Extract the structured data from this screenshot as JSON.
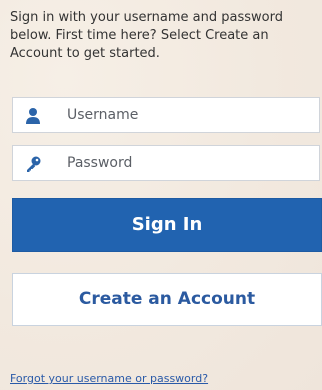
{
  "intro": {
    "text": "Sign in with your username and password below. First time here? Select Create an Account to get started."
  },
  "username": {
    "placeholder": "Username",
    "value": "",
    "icon": "user-icon"
  },
  "password": {
    "placeholder": "Password",
    "value": "",
    "icon": "key-icon"
  },
  "buttons": {
    "signin_label": "Sign In",
    "create_label": "Create an Account"
  },
  "links": {
    "forgot_label": "Forgot your username or password?"
  },
  "colors": {
    "primary": "#2163b0",
    "link": "#2a5aa8",
    "icon": "#2b64a9",
    "background": "#f2e9df"
  }
}
